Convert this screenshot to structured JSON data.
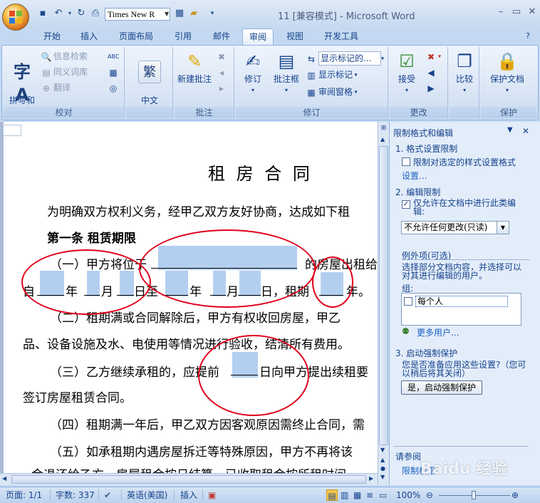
{
  "window": {
    "title": "11 [兼容模式] - Microsoft Word",
    "font_name": "Times New R"
  },
  "tabs": [
    "开始",
    "插入",
    "页面布局",
    "引用",
    "邮件",
    "审阅",
    "视图",
    "开发工具"
  ],
  "active_tab": "审阅",
  "ribbon": {
    "proofing": {
      "group_label": "校对",
      "spelling": "拼写和\n语法",
      "research": "信息检索",
      "thesaurus": "同义词库",
      "translate": "翻译"
    },
    "chinese": {
      "group_label": "",
      "convert": "中文\n简繁转换"
    },
    "comments": {
      "group_label": "批注",
      "new_comment": "新建批注"
    },
    "tracking": {
      "group_label": "修订",
      "track_changes": "修订",
      "balloons": "批注框",
      "display_dropdown": "显示标记的...",
      "show_markup": "显示标记",
      "reviewing_pane": "审阅窗格"
    },
    "changes": {
      "group_label": "更改",
      "accept": "接受"
    },
    "compare": {
      "compare": "比较"
    },
    "protect": {
      "group_label": "保护",
      "protect_document": "保护文档"
    }
  },
  "document": {
    "title": "租 房 合 同",
    "line1": "为明确双方权利义务，经甲乙双方友好协商，达成如下租",
    "article1": "第一条   租赁期限",
    "clause1_a": "（一）甲方将位于",
    "clause1_b": "的房屋出租给",
    "clause1_line2_parts": [
      "自",
      "年",
      "月",
      "日至",
      "年",
      "月",
      "日，租期",
      "年。"
    ],
    "clause2": "（二）租期满或合同解除后，甲方有权收回房屋，甲乙",
    "clause2_cont": "品、设备设施及水、电使用等情况进行验收，结清所有费用。",
    "clause3_a": "（三）乙方继续承租的，应提前",
    "clause3_b": "日向甲方提出续租要",
    "clause3_cont": "签订房屋租赁合同。",
    "clause4": "（四）租期满一年后，甲乙双方因客观原因需终止合同，需",
    "clause5": "（五）如承租期内遇房屋拆迁等特殊原因，甲方不再将该",
    "clause5_cont": "金退还给乙方，房屋租金按日结算，已收取租金按所租时间"
  },
  "task_pane": {
    "title": "限制格式和编辑",
    "section1": "1.  格式设置限制",
    "section1_check": "限制对选定的样式设置格式",
    "section1_link": "设置...",
    "section2": "2.  编辑限制",
    "section2_check_line1": "仅允许在文档中进行此类编",
    "section2_check_line2": "辑:",
    "editing_type": "不允许任何更改(只读)",
    "exceptions_header": "例外项(可选)",
    "exceptions_desc_line1": "选择部分文档内容，并选择可以",
    "exceptions_desc_line2": "对其进行编辑的用户。",
    "groups_label": "组:",
    "group_everyone": "每个人",
    "more_users": "更多用户...",
    "section3": "3.  启动强制保护",
    "section3_q_line1": "您是否准备应用这些设置?（您可",
    "section3_q_line2": "以稍后将其关闭）",
    "start_button": "是，启动强制保护",
    "see_also": "请参阅",
    "restrict_permission": "限制权限"
  },
  "statusbar": {
    "page": "页面: 1/1",
    "words": "字数: 337",
    "language": "英语(美国)",
    "insert_mode": "插入",
    "zoom": "100%"
  },
  "watermark": "Baidu 经验"
}
